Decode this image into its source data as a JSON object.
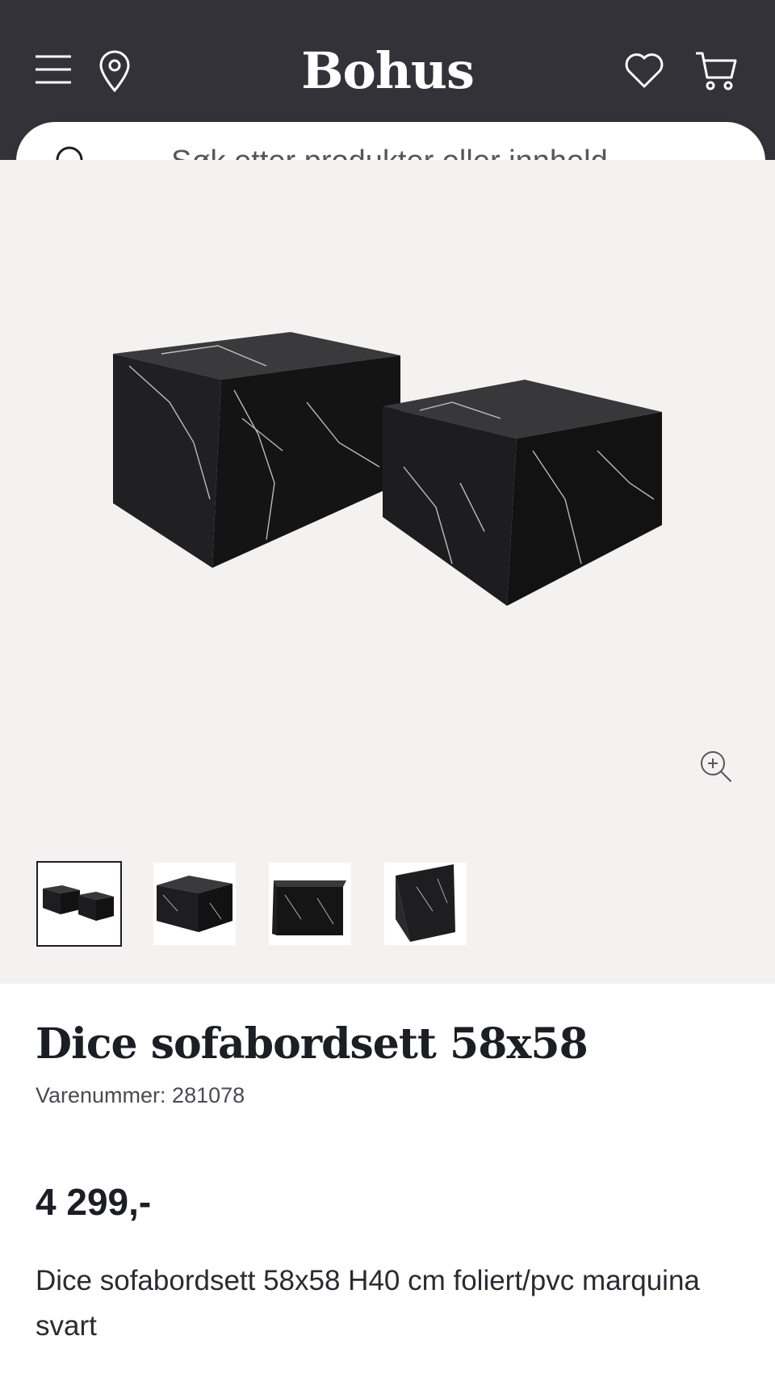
{
  "header": {
    "logo": "Bohus",
    "icons": [
      "menu-icon",
      "location-pin-icon",
      "heart-icon",
      "cart-icon"
    ],
    "background": "#333239"
  },
  "search": {
    "placeholder": "Søk etter produkter eller innhold ..."
  },
  "gallery": {
    "thumbnails": [
      "dice-set-both-tables",
      "dice-single-table-angle",
      "dice-single-table-front",
      "dice-single-table-side"
    ],
    "selected_index": 0
  },
  "product": {
    "title": "Dice sofabordsett 58x58",
    "sku_label": "Varenummer: 281078",
    "price": "4 299,-",
    "description": "Dice sofabordsett 58x58 H40 cm foliert/pvc marquina svart"
  },
  "colors": {
    "topbar": "#333239",
    "gallery_bg": "#f4f2f1",
    "text": "#1d1e24"
  }
}
